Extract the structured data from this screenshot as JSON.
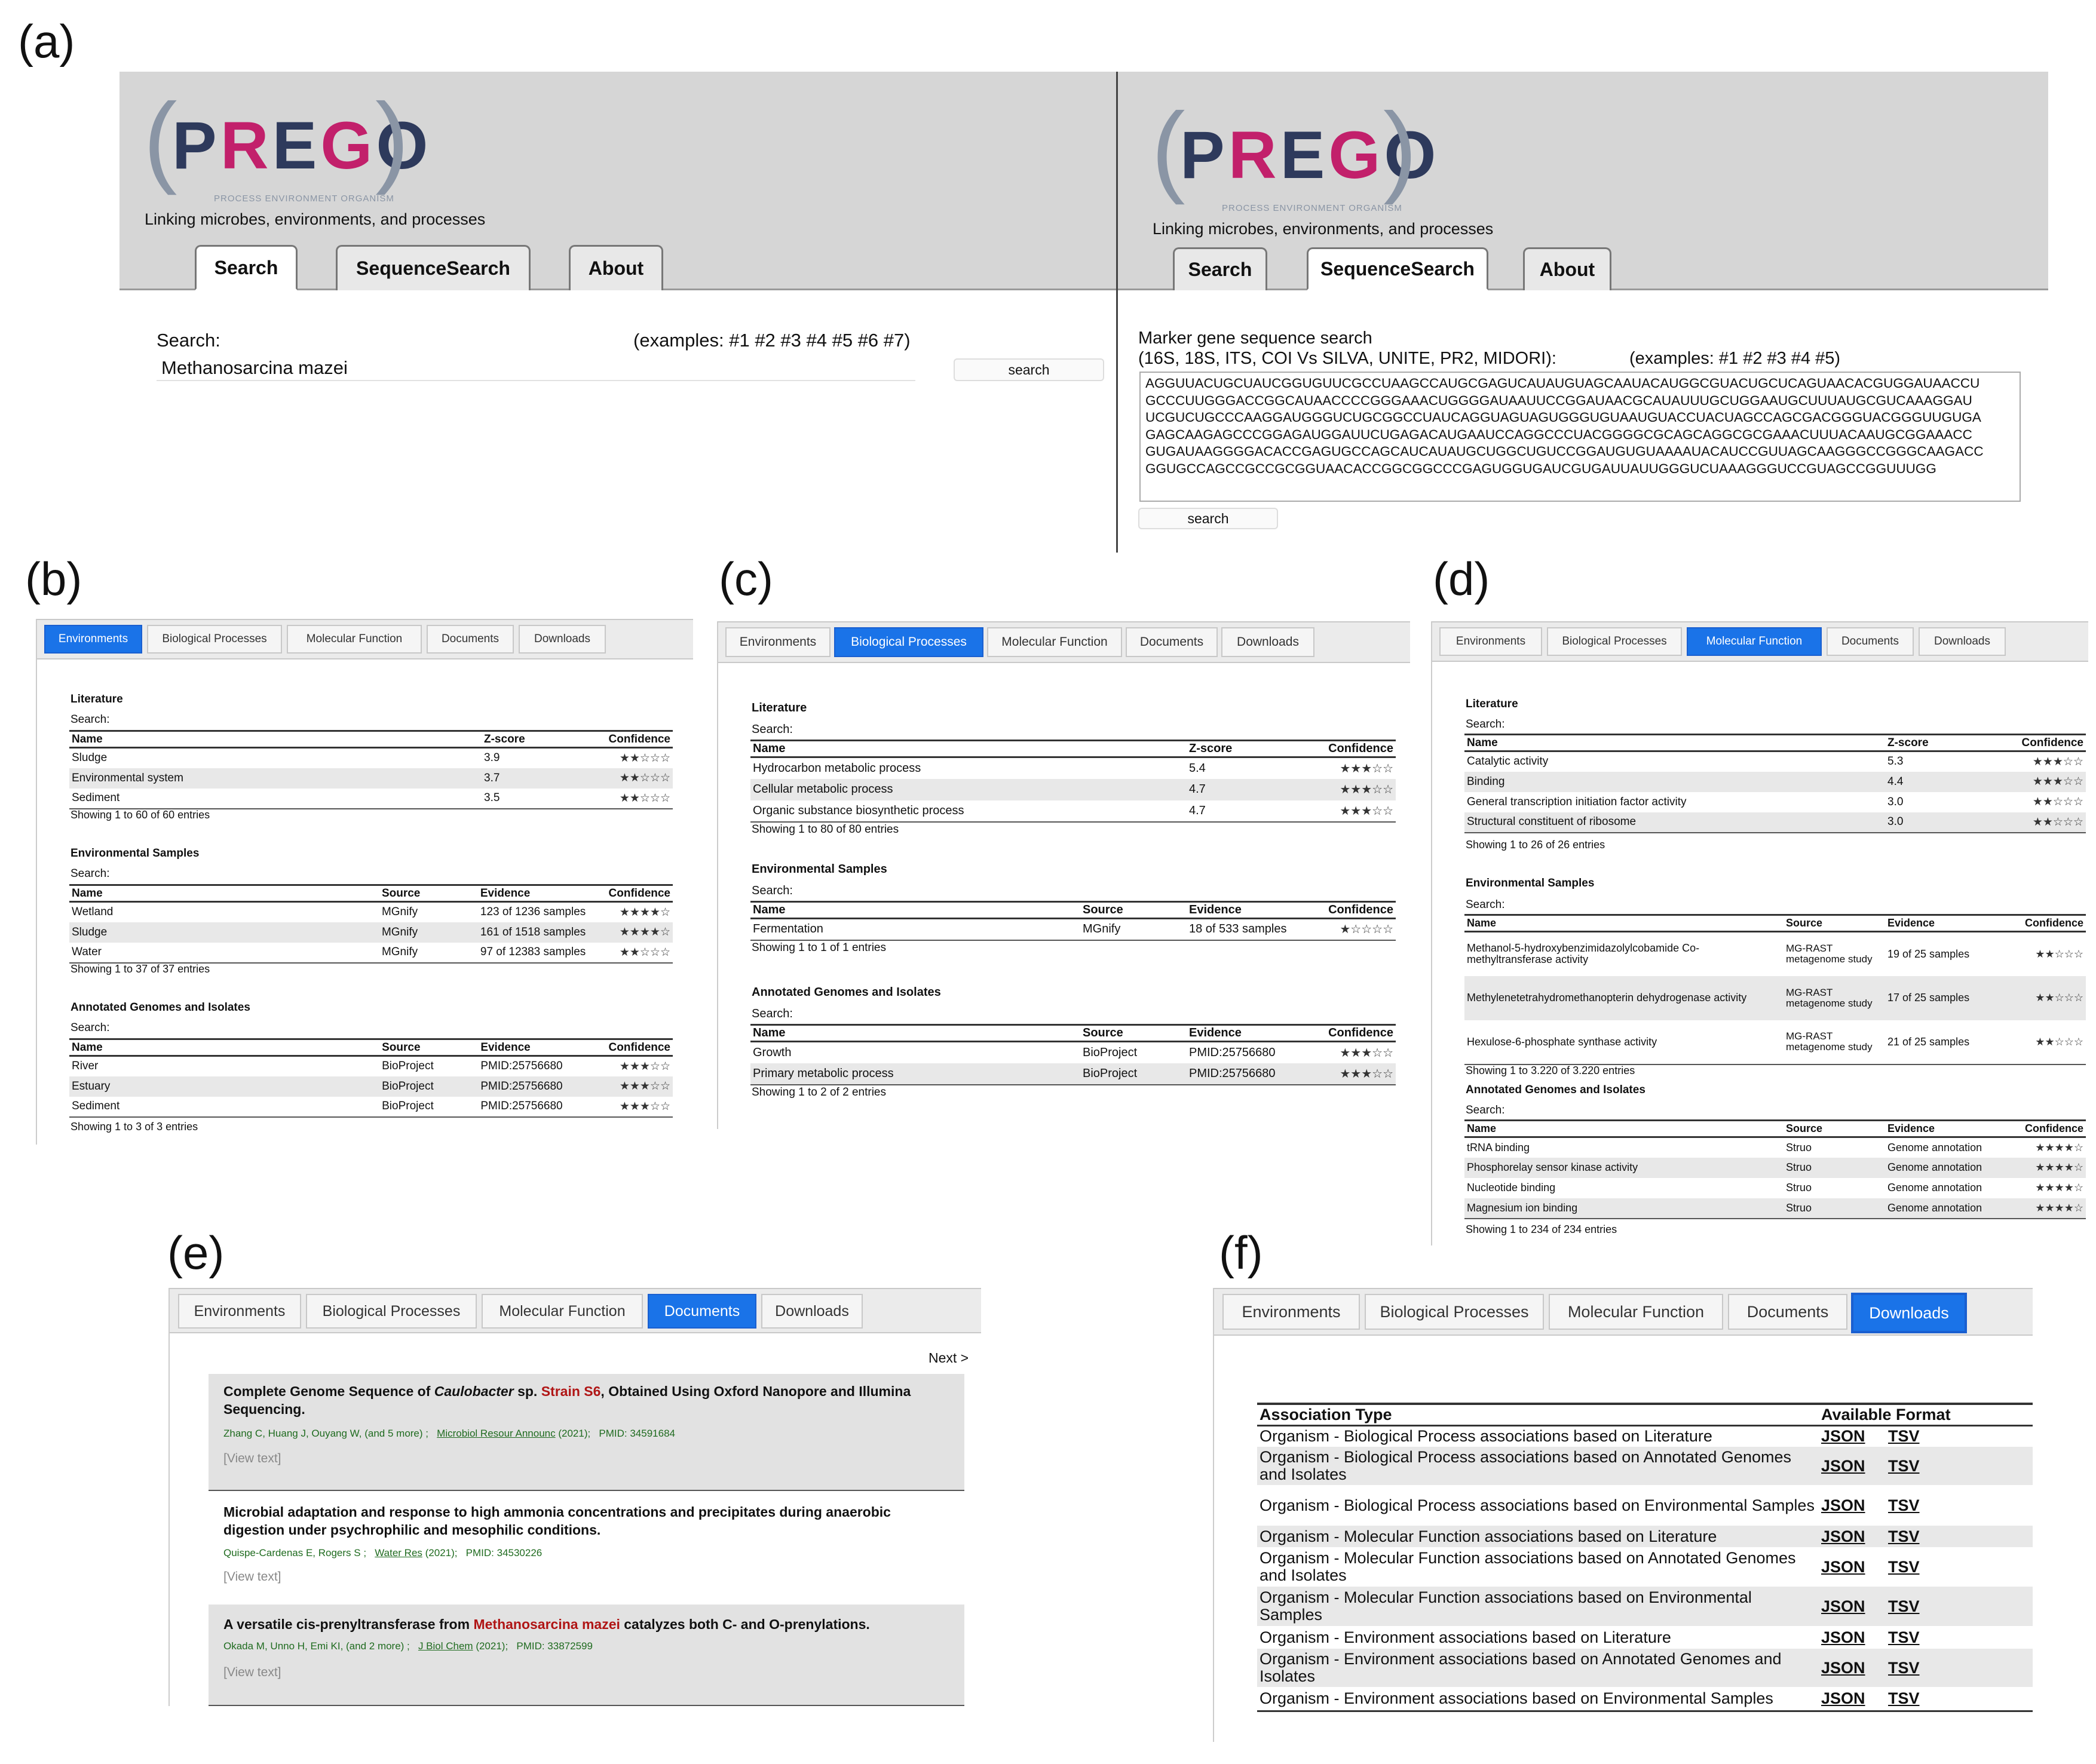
{
  "labels": {
    "a": "(a)",
    "b": "(b)",
    "c": "(c)",
    "d": "(d)",
    "e": "(e)",
    "f": "(f)"
  },
  "logo": {
    "bracket_left": "(",
    "bracket_right": ")",
    "word_p": "P",
    "word_r": "R",
    "word_e": "E",
    "word_g": "G",
    "word_o": "O",
    "subtitle": "PROCESS ENVIRONMENT ORGANISM"
  },
  "tagline": "Linking microbes, environments, and processes",
  "nav_tabs": [
    "Search",
    "SequenceSearch",
    "About"
  ],
  "search_panel": {
    "label": "Search:",
    "examples": "(examples: #1 #2 #3 #4 #5 #6 #7)",
    "value": "Methanosarcina mazei",
    "button": "search"
  },
  "seq_panel": {
    "label_line1": "Marker gene sequence search",
    "label_line2": "(16S, 18S, ITS, COI Vs SILVA, UNITE, PR2, MIDORI):",
    "examples": "(examples: #1 #2 #3 #4 #5)",
    "button": "search",
    "sequence": "AGGUUACUGCUAUCGGUGUUCGCCUAAGCCAUGCGAGUCAUAUGUAGCAAUACAUGGCGUACUGCUCAGUAACACGUGGAUAACCU\nGCCCUUGGGACCGGCAUAACCCCGGGAAACUGGGGAUAAUUCCGGAUAACGCAUAUUUGCUGGAAUGCUUUAUGCGUCAAAGGAU\nUCGUCUGCCCAAGGAUGGGUCUGCGGCCUAUCAGGUAGUAGUGGGUGUAAUGUACCUACUAGCCAGCGACGGGUACGGGUUGUGA\nGAGCAAGAGCCCGGAGAUGGAUUCUGAGACAUGAAUCCAGGCCCUACGGGGCGCAGCAGGCGCGAAACUUUACAAUGCGGAAACC\nGUGAUAAGGGGACACCGAGUGCCAGCAUCAUAUGCUGGCUGUCCGGAUGUGUAAAAUACAUCCGUUAGCAAGGGCCGGGCAAGACC\nGGUGCCAGCCGCCGCGGUAACACCGGCGGCCCGAGUGGUGAUCGUGAUUAUUGGGUCUAAAGGGUCCGUAGCCGGUUUGG"
  },
  "result_tabs": [
    "Environments",
    "Biological Processes",
    "Molecular Function",
    "Documents",
    "Downloads"
  ],
  "common": {
    "search_label": "Search:",
    "literature": "Literature",
    "env_samples": "Environmental Samples",
    "genomes": "Annotated Genomes and Isolates",
    "h_name": "Name",
    "h_zscore": "Z-score",
    "h_confidence": "Confidence",
    "h_source": "Source",
    "h_evidence": "Evidence"
  },
  "panel_b": {
    "literature": [
      [
        "Sludge",
        "3.9",
        "★★☆☆☆"
      ],
      [
        "Environmental system",
        "3.7",
        "★★☆☆☆"
      ],
      [
        "Sediment",
        "3.5",
        "★★☆☆☆"
      ]
    ],
    "lit_showing": "Showing 1 to 60 of 60 entries",
    "samples": [
      [
        "Wetland",
        "MGnify",
        "123 of 1236 samples",
        "★★★★☆"
      ],
      [
        "Sludge",
        "MGnify",
        "161 of 1518 samples",
        "★★★★☆"
      ],
      [
        "Water",
        "MGnify",
        "97 of 12383 samples",
        "★★☆☆☆"
      ]
    ],
    "samples_showing": "Showing 1 to 37 of 37 entries",
    "genomes": [
      [
        "River",
        "BioProject",
        "PMID:25756680",
        "★★★☆☆"
      ],
      [
        "Estuary",
        "BioProject",
        "PMID:25756680",
        "★★★☆☆"
      ],
      [
        "Sediment",
        "BioProject",
        "PMID:25756680",
        "★★★☆☆"
      ]
    ],
    "genomes_showing": "Showing 1 to 3 of 3 entries"
  },
  "panel_c": {
    "literature": [
      [
        "Hydrocarbon metabolic process",
        "5.4",
        "★★★☆☆"
      ],
      [
        "Cellular metabolic process",
        "4.7",
        "★★★☆☆"
      ],
      [
        "Organic substance biosynthetic process",
        "4.7",
        "★★★☆☆"
      ]
    ],
    "lit_showing": "Showing 1 to 80 of 80 entries",
    "samples": [
      [
        "Fermentation",
        "MGnify",
        "18 of 533 samples",
        "★☆☆☆☆"
      ]
    ],
    "samples_showing": "Showing 1 to 1 of 1 entries",
    "genomes": [
      [
        "Growth",
        "BioProject",
        "PMID:25756680",
        "★★★☆☆"
      ],
      [
        "Primary metabolic process",
        "BioProject",
        "PMID:25756680",
        "★★★☆☆"
      ]
    ],
    "genomes_showing": "Showing 1 to 2 of 2 entries"
  },
  "panel_d": {
    "literature": [
      [
        "Catalytic activity",
        "5.3",
        "★★★☆☆"
      ],
      [
        "Binding",
        "4.4",
        "★★★☆☆"
      ],
      [
        "General transcription initiation factor activity",
        "3.0",
        "★★☆☆☆"
      ],
      [
        "Structural constituent of ribosome",
        "3.0",
        "★★☆☆☆"
      ]
    ],
    "lit_showing": "Showing 1 to 26 of 26 entries",
    "samples": [
      [
        "Methanol-5-hydroxybenzimidazolylcobamide Co-methyltransferase activity",
        "MG-RAST metagenome study",
        "19 of 25 samples",
        "★★☆☆☆"
      ],
      [
        "Methylenetetrahydromethanopterin dehydrogenase activity",
        "MG-RAST metagenome study",
        "17 of 25 samples",
        "★★☆☆☆"
      ],
      [
        "Hexulose-6-phosphate synthase activity",
        "MG-RAST metagenome study",
        "21 of 25 samples",
        "★★☆☆☆"
      ]
    ],
    "samples_showing": "Showing 1 to 3.220 of 3.220 entries",
    "genomes": [
      [
        "tRNA binding",
        "Struo",
        "Genome annotation",
        "★★★★☆"
      ],
      [
        "Phosphorelay sensor kinase activity",
        "Struo",
        "Genome annotation",
        "★★★★☆"
      ],
      [
        "Nucleotide binding",
        "Struo",
        "Genome annotation",
        "★★★★☆"
      ],
      [
        "Magnesium ion binding",
        "Struo",
        "Genome annotation",
        "★★★★☆"
      ]
    ],
    "genomes_showing": "Showing 1 to 234 of 234 entries"
  },
  "panel_e": {
    "next": "Next >",
    "docs": [
      {
        "t1": "Complete Genome Sequence of ",
        "t_italic": "Caulobacter",
        "t2": " sp. ",
        "t_red": "Strain S6",
        "t3": ", Obtained Using Oxford Nanopore and Illumina Sequencing.",
        "authors": "Zhang C, Huang J, Ouyang W, (and 5 more) ;",
        "journal": "Microbiol Resour Announc",
        "year": " (2021);",
        "pmid": "PMID: 34591684",
        "view": "[View text]"
      },
      {
        "t1": "Microbial adaptation and response to high ammonia concentrations and precipitates during anaerobic digestion under psychrophilic and mesophilic conditions.",
        "t_italic": "",
        "t2": "",
        "t_red": "",
        "t3": "",
        "authors": "Quispe-Cardenas E, Rogers S ;",
        "journal": "Water Res",
        "year": " (2021);",
        "pmid": "PMID: 34530226",
        "view": "[View text]"
      },
      {
        "t1": "A versatile cis-prenyltransferase from ",
        "t_italic": "",
        "t2": "",
        "t_red": "Methanosarcina mazei",
        "t3": " catalyzes both C- and O-prenylations.",
        "authors": "Okada M, Unno H, Emi KI, (and 2 more) ;",
        "journal": "J Biol Chem",
        "year": " (2021);",
        "pmid": "PMID: 33872599",
        "view": "[View text]"
      }
    ]
  },
  "panel_f": {
    "h_type": "Association Type",
    "h_format": "Available Format",
    "json": "JSON",
    "tsv": "TSV",
    "rows": [
      "Organism - Biological Process associations based on Literature",
      "Organism - Biological Process associations based on Annotated Genomes and Isolates",
      "Organism - Biological Process associations based on Environmental Samples",
      "Organism - Molecular Function associations based on Literature",
      "Organism - Molecular Function associations based on Annotated Genomes and Isolates",
      "Organism - Molecular Function associations based on Environmental Samples",
      "Organism - Environment associations based on Literature",
      "Organism - Environment associations based on Annotated Genomes and Isolates",
      "Organism - Environment associations based on Environmental Samples"
    ]
  },
  "colors": {
    "active_tab": "#1a73e8",
    "header_bg": "#d6d6d6",
    "logo_dark": "#2e3a5c",
    "logo_pink": "#c2206b",
    "highlight_red": "#b01515",
    "meta_green": "#1f6b1f"
  }
}
